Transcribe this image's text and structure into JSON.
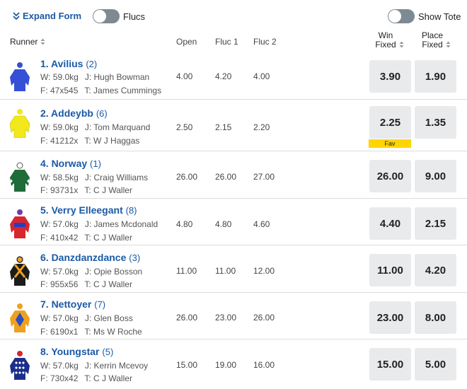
{
  "toolbar": {
    "expand_label": "Expand Form",
    "flucs_label": "Flucs",
    "tote_label": "Show Tote"
  },
  "columns": {
    "runner": "Runner",
    "open": "Open",
    "fluc1": "Fluc 1",
    "fluc2": "Fluc 2",
    "win_line1": "Win",
    "win_line2": "Fixed",
    "place_line1": "Place",
    "place_line2": "Fixed"
  },
  "runners": [
    {
      "name": "1. Avilius",
      "barrier": "(2)",
      "weight": "W: 59.0kg",
      "jockey": "J: Hugh Bowman",
      "form": "F: 47x545",
      "trainer": "T: James Cummings",
      "open": "4.00",
      "fluc1": "4.20",
      "fluc2": "4.00",
      "win": "3.90",
      "place": "1.90",
      "fav": "",
      "silk": "blue-jersey-icon",
      "silk_color": "#3550d6"
    },
    {
      "name": "2. Addeybb",
      "barrier": "(6)",
      "weight": "W: 59.0kg",
      "jockey": "J: Tom Marquand",
      "form": "F: 41212x",
      "trainer": "T: W J Haggas",
      "open": "2.50",
      "fluc1": "2.15",
      "fluc2": "2.20",
      "win": "2.25",
      "place": "1.35",
      "fav": "Fav",
      "silk": "yellow-jersey-icon",
      "silk_color": "#f2e81c"
    },
    {
      "name": "4. Norway",
      "barrier": "(1)",
      "weight": "W: 58.5kg",
      "jockey": "J: Craig Williams",
      "form": "F: 93731x",
      "trainer": "T: C J Waller",
      "open": "26.00",
      "fluc1": "26.00",
      "fluc2": "27.00",
      "win": "26.00",
      "place": "9.00",
      "fav": "",
      "silk": "green-jersey-icon",
      "silk_color": "#1f6b3a"
    },
    {
      "name": "5. Verry Elleegant",
      "barrier": "(8)",
      "weight": "W: 57.0kg",
      "jockey": "J: James Mcdonald",
      "form": "F: 410x42",
      "trainer": "T: C J Waller",
      "open": "4.80",
      "fluc1": "4.80",
      "fluc2": "4.60",
      "win": "4.40",
      "place": "2.15",
      "fav": "",
      "silk": "red-blue-jersey-icon",
      "silk_color": "#d8262e"
    },
    {
      "name": "6. Danzdanzdance",
      "barrier": "(3)",
      "weight": "W: 57.0kg",
      "jockey": "J: Opie Bosson",
      "form": "F: 955x56",
      "trainer": "T: C J Waller",
      "open": "11.00",
      "fluc1": "11.00",
      "fluc2": "12.00",
      "win": "11.00",
      "place": "4.20",
      "fav": "",
      "silk": "black-orange-jersey-icon",
      "silk_color": "#1c1c1c"
    },
    {
      "name": "7. Nettoyer",
      "barrier": "(7)",
      "weight": "W: 57.0kg",
      "jockey": "J: Glen Boss",
      "form": "F: 6190x1",
      "trainer": "T: Ms W Roche",
      "open": "26.00",
      "fluc1": "23.00",
      "fluc2": "26.00",
      "win": "23.00",
      "place": "8.00",
      "fav": "",
      "silk": "orange-blue-jersey-icon",
      "silk_color": "#f0a020"
    },
    {
      "name": "8. Youngstar",
      "barrier": "(5)",
      "weight": "W: 57.0kg",
      "jockey": "J: Kerrin Mcevoy",
      "form": "F: 730x42",
      "trainer": "T: C J Waller",
      "open": "15.00",
      "fluc1": "19.00",
      "fluc2": "16.00",
      "win": "15.00",
      "place": "5.00",
      "fav": "",
      "silk": "navy-diamond-jersey-icon",
      "silk_color": "#1b2f8a"
    }
  ]
}
